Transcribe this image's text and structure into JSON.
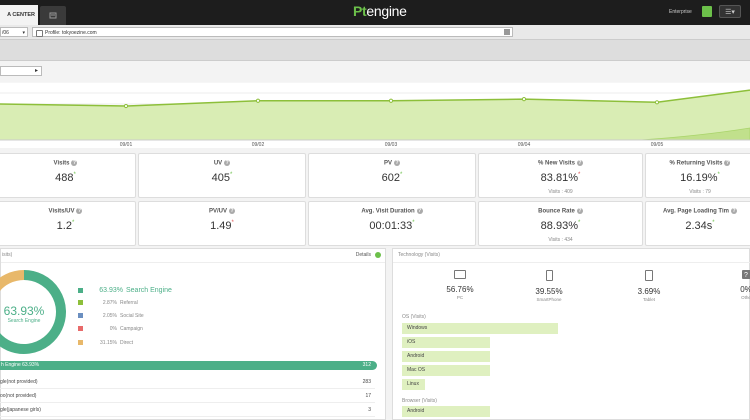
{
  "topbar": {
    "tab_label": "A CENTER",
    "logo_prefix": "Pt",
    "logo_suffix": "engine",
    "user_label": "Enterprise",
    "menu_icon": "list-icon"
  },
  "filters": {
    "date_value": "/06",
    "profile_value": "Profile: tokyoezine.com"
  },
  "segment": {
    "selector_arrow": "▸"
  },
  "chart_data": {
    "type": "area",
    "categories": [
      "09/01",
      "09/02",
      "09/03",
      "09/04",
      "09/05"
    ],
    "x_tick_labels": [
      "09/01",
      "09/02",
      "09/03",
      "09/04",
      "09/05"
    ],
    "title": "",
    "xlabel": "",
    "ylabel": "",
    "grid": true,
    "series": [
      {
        "values": [
          62,
          66,
          66,
          67,
          65,
          86
        ],
        "color": "#8dbf3a"
      },
      {
        "values": [
          0,
          0,
          0,
          0,
          0,
          22
        ],
        "color": "#c8e6a0"
      }
    ]
  },
  "kpi_row1": [
    {
      "label": "Visits",
      "value": "488",
      "trend": "up",
      "sub": ""
    },
    {
      "label": "UV",
      "value": "405",
      "trend": "up",
      "sub": ""
    },
    {
      "label": "PV",
      "value": "602",
      "trend": "up",
      "sub": ""
    },
    {
      "label": "% New Visits",
      "value": "83.81%",
      "trend": "down",
      "sub": "Visits : 409"
    },
    {
      "label": "% Returning Visits",
      "value": "16.19%",
      "trend": "up",
      "sub": "Visits : 79"
    }
  ],
  "kpi_row2": [
    {
      "label": "Visits/UV",
      "value": "1.2",
      "trend": "up",
      "sub": ""
    },
    {
      "label": "PV/UV",
      "value": "1.49",
      "trend": "down",
      "sub": ""
    },
    {
      "label": "Avg. Visit Duration",
      "value": "00:01:33",
      "trend": "up",
      "sub": ""
    },
    {
      "label": "Bounce Rate",
      "value": "88.93%",
      "trend": "up",
      "sub": "Visits : 434"
    },
    {
      "label": "Avg. Page Loading Tim",
      "value": "2.34s",
      "trend": "up",
      "sub": ""
    }
  ],
  "source_panel": {
    "header_title": "isits)",
    "details_label": "Details",
    "donut_pct": "63.93%",
    "donut_label": "Search Engine",
    "legend": [
      {
        "pct": "63.93%",
        "name": "Search Engine",
        "color": "#4caf88"
      },
      {
        "pct": "2.87%",
        "name": "Referral",
        "color": "#8dbf3a"
      },
      {
        "pct": "2.05%",
        "name": "Social Site",
        "color": "#6b8fc0"
      },
      {
        "pct": "0%",
        "name": "Campaign",
        "color": "#e86a6a"
      },
      {
        "pct": "31.15%",
        "name": "Direct",
        "color": "#e8b86a"
      }
    ],
    "donut_fractions": [
      0.6393,
      0.0287,
      0.0205,
      0.0,
      0.3115
    ],
    "bar_label": "h Engine 63.93%",
    "bar_count": "312",
    "rows": [
      {
        "label": "gle(not provided)",
        "count": "283"
      },
      {
        "label": "oo(not provided)",
        "count": "17"
      },
      {
        "label": "gle(japanese girls)",
        "count": "3"
      }
    ]
  },
  "tech_panel": {
    "header_title": "Technology (Visits)",
    "devices": [
      {
        "pct": "56.76%",
        "name": "PC",
        "icon": "monitor-icon"
      },
      {
        "pct": "39.55%",
        "name": "SmartPhone",
        "icon": "smartphone-icon"
      },
      {
        "pct": "3.69%",
        "name": "Tablet",
        "icon": "tablet-icon"
      },
      {
        "pct": "0%",
        "name": "Othe",
        "icon": "question-icon"
      }
    ],
    "os_title": "OS (Visits)",
    "os": [
      {
        "name": "Windows",
        "share": 0.8
      },
      {
        "name": "iOS",
        "share": 0.45
      },
      {
        "name": "Android",
        "share": 0.45
      },
      {
        "name": "Mac OS",
        "share": 0.45
      },
      {
        "name": "Linux",
        "share": 0.12
      }
    ],
    "browser_title": "Browser (Visits)",
    "browser": [
      {
        "name": "Android",
        "share": 0.45
      }
    ]
  }
}
